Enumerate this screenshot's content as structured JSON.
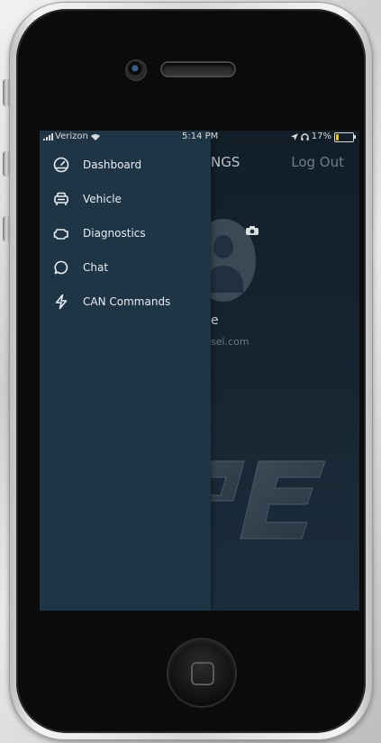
{
  "status_bar": {
    "carrier": "Verizon",
    "time": "5:14 PM",
    "battery": "17%",
    "battery_fraction": 0.17
  },
  "header": {
    "title_partial": "NGS",
    "logout_label": "Log Out"
  },
  "profile": {
    "name_partial": "e",
    "email_partial": "sel.com"
  },
  "drawer": {
    "items": [
      {
        "label": "Dashboard",
        "icon": "dashboard-icon"
      },
      {
        "label": "Vehicle",
        "icon": "vehicle-icon"
      },
      {
        "label": "Diagnostics",
        "icon": "engine-icon"
      },
      {
        "label": "Chat",
        "icon": "chat-icon"
      },
      {
        "label": "CAN Commands",
        "icon": "lightning-icon"
      }
    ]
  },
  "logo_text": "SPE",
  "colors": {
    "drawer_bg": "#1e3545",
    "screen_bg": "#16232f",
    "battery_low": "#f2c400",
    "text": "#e8eef2"
  }
}
